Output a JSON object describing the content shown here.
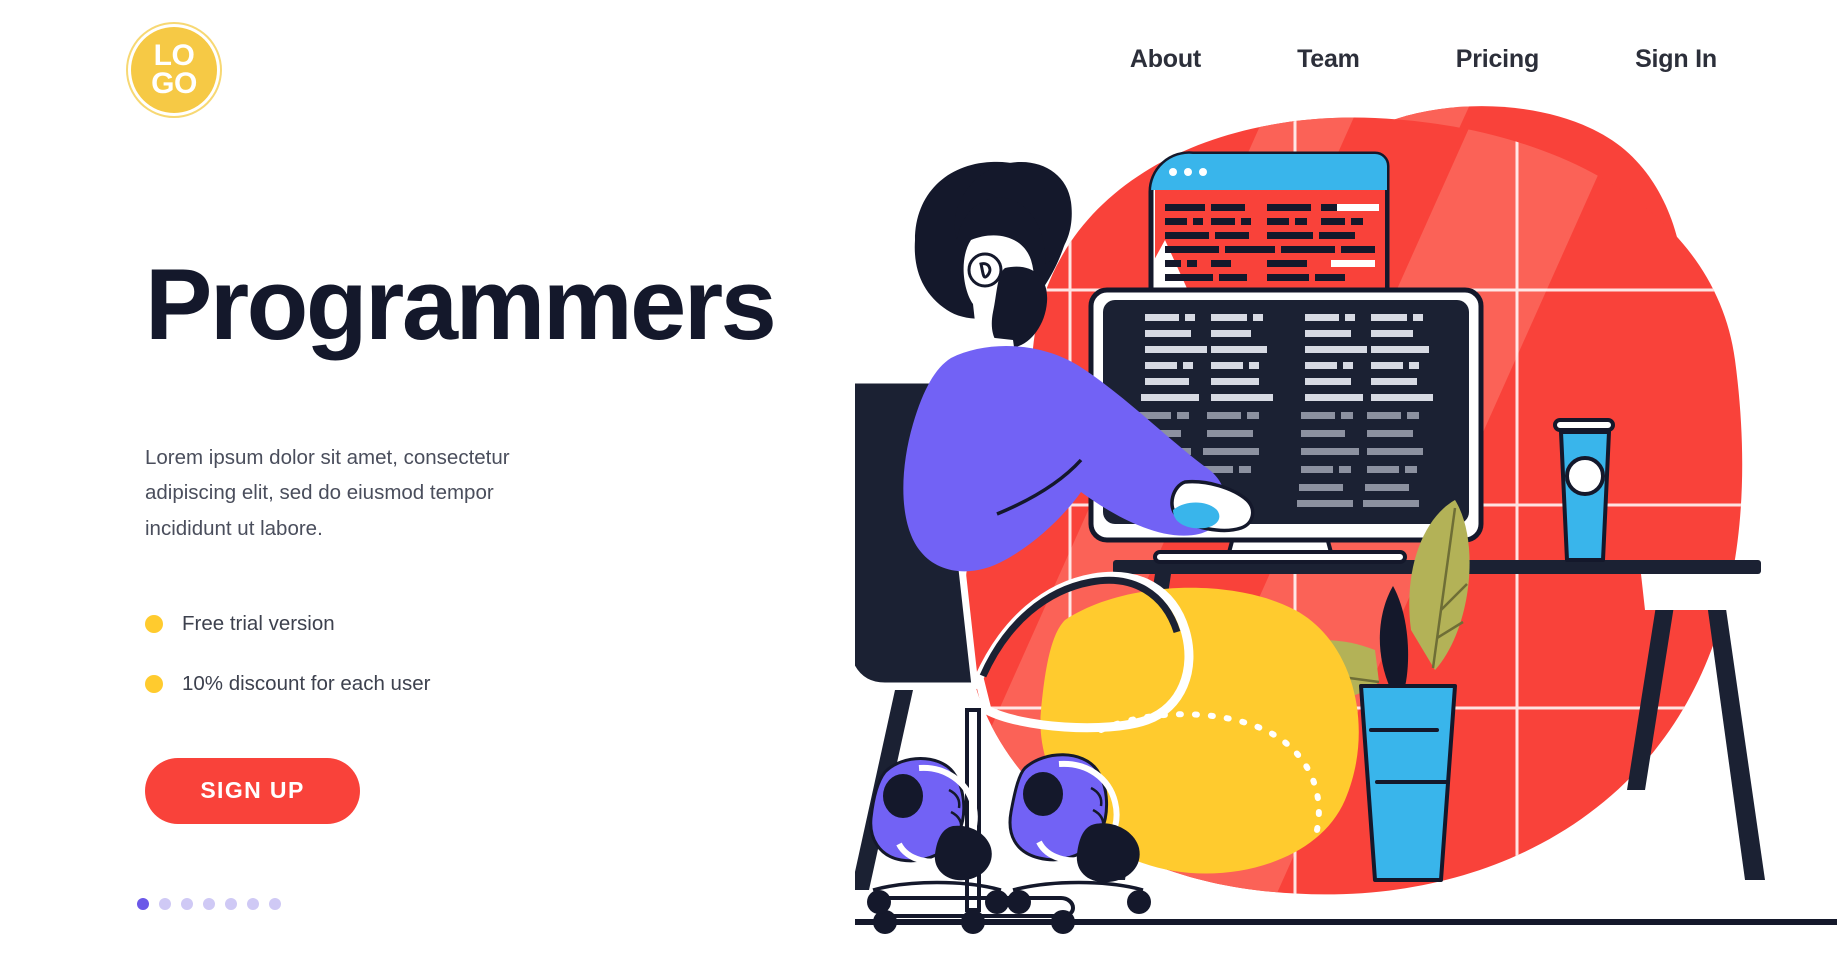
{
  "header": {
    "logo": {
      "line1": "LO",
      "line2": "GO",
      "name": "logo-badge"
    },
    "nav": [
      {
        "label": "About"
      },
      {
        "label": "Team"
      },
      {
        "label": "Pricing"
      },
      {
        "label": "Sign In"
      }
    ]
  },
  "hero": {
    "title": "Programmers",
    "description": "Lorem ipsum dolor sit amet, consectetur adipiscing elit, sed do eiusmod tempor incididunt ut labore.",
    "features": [
      {
        "label": "Free trial version"
      },
      {
        "label": "10% discount for each user"
      }
    ],
    "cta": {
      "label": "SIGN UP"
    }
  },
  "carousel": {
    "total": 7,
    "active_index": 0
  },
  "illustration": {
    "name": "programmer-at-desk-illustration",
    "scene_elements": [
      "red-blob-background",
      "white-grid-lines",
      "diagonal-highlight-stripes",
      "man-with-beard",
      "purple-shirt",
      "yellow-pants",
      "purple-sneakers",
      "black-office-chair",
      "desktop-monitor-dark-code",
      "laptop-screen-light-code",
      "blue-coffee-cup",
      "blue-plant-pot",
      "olive-leaves",
      "black-desk",
      "floor-line"
    ]
  },
  "colors": {
    "red": "#F9423A",
    "red_light": "#FB6257",
    "yellow": "#FFCB2E",
    "logo_yellow": "#F6C945",
    "purple": "#7262F5",
    "indigo": "#6B58E8",
    "lavender": "#CFC9F5",
    "dark": "#14182B",
    "navy": "#1B2133",
    "blue": "#39B5EB",
    "olive": "#B3B257",
    "text_gray": "#4A4E5C",
    "white": "#FFFFFF",
    "code_light": "#D7DAE3",
    "code_gray": "#8C91A0"
  }
}
